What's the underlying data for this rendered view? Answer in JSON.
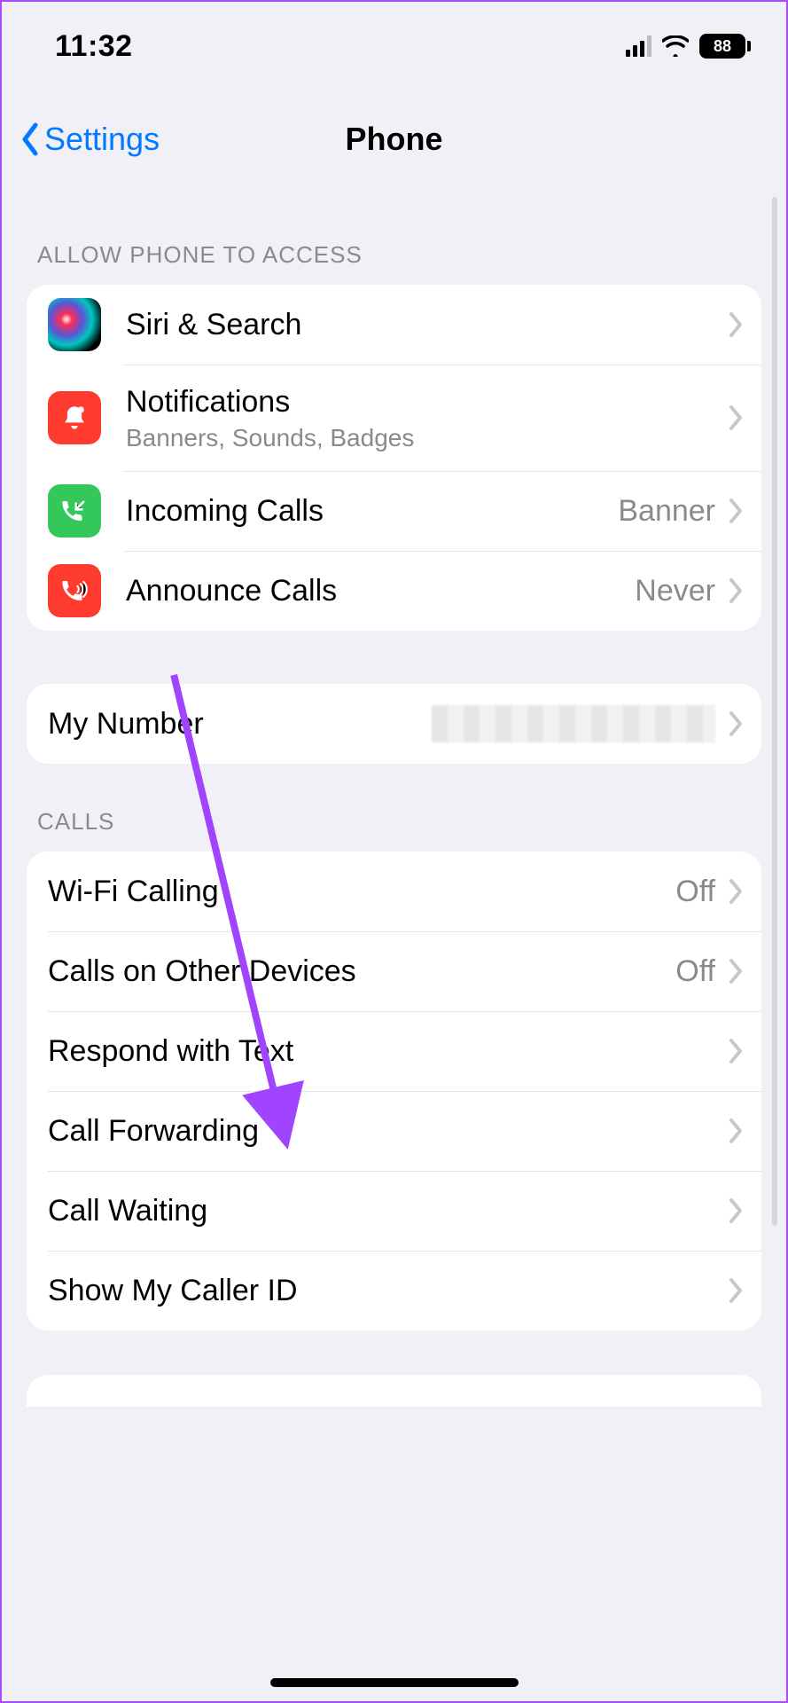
{
  "status": {
    "time": "11:32",
    "battery_pct": "88"
  },
  "nav": {
    "back_label": "Settings",
    "title": "Phone"
  },
  "sections": {
    "access_header": "ALLOW PHONE TO ACCESS",
    "calls_header": "CALLS"
  },
  "rows": {
    "siri": {
      "label": "Siri & Search"
    },
    "notifications": {
      "label": "Notifications",
      "sub": "Banners, Sounds, Badges"
    },
    "incoming": {
      "label": "Incoming Calls",
      "detail": "Banner"
    },
    "announce": {
      "label": "Announce Calls",
      "detail": "Never"
    },
    "my_number": {
      "label": "My Number"
    },
    "wifi_calling": {
      "label": "Wi-Fi Calling",
      "detail": "Off"
    },
    "other_devices": {
      "label": "Calls on Other Devices",
      "detail": "Off"
    },
    "respond_text": {
      "label": "Respond with Text"
    },
    "call_forwarding": {
      "label": "Call Forwarding"
    },
    "call_waiting": {
      "label": "Call Waiting"
    },
    "caller_id": {
      "label": "Show My Caller ID"
    }
  }
}
